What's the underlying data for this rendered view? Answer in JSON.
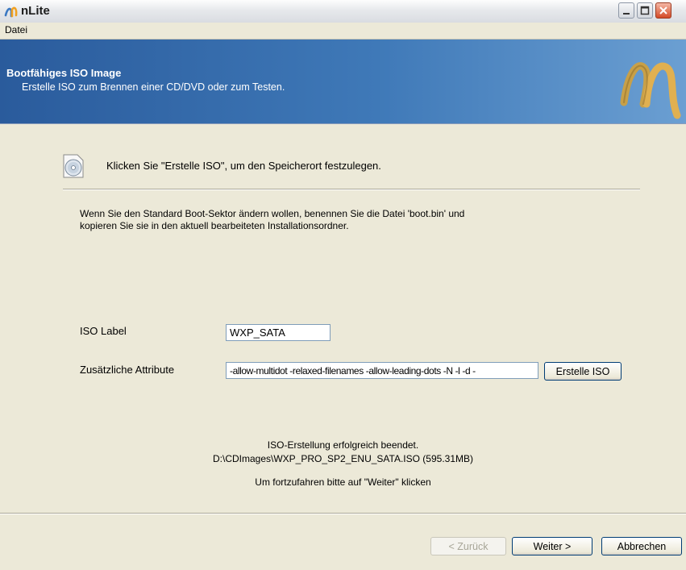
{
  "window": {
    "title": "nLite"
  },
  "menu": {
    "items": [
      "Datei"
    ]
  },
  "header": {
    "title": "Bootfähiges ISO Image",
    "subtitle": "Erstelle ISO zum Brennen einer CD/DVD oder zum Testen."
  },
  "content": {
    "instruction": "Klicken Sie \"Erstelle ISO\", um den Speicherort festzulegen.",
    "info_line1": "Wenn Sie den Standard Boot-Sektor ändern wollen, benennen Sie die Datei 'boot.bin' und",
    "info_line2": "kopieren Sie sie in den aktuell bearbeiteten Installationsordner.",
    "iso_label": {
      "label": "ISO Label",
      "value": "WXP_SATA"
    },
    "attributes": {
      "label": "Zusätzliche Attribute",
      "value": "-allow-multidot -relaxed-filenames -allow-leading-dots -N -l -d -"
    },
    "create_button": "Erstelle ISO",
    "status_line1": "ISO-Erstellung erfolgreich beendet.",
    "status_line2": "D:\\CDImages\\WXP_PRO_SP2_ENU_SATA.ISO (595.31MB)",
    "continue_hint": "Um fortzufahren bitte auf \"Weiter\" klicken"
  },
  "footer": {
    "back": "< Zurück",
    "next": "Weiter >",
    "cancel": "Abbrechen"
  },
  "icons": [
    "nlite-app-icon",
    "minimize-icon",
    "maximize-icon",
    "close-icon",
    "nlite-logo",
    "cd-icon"
  ],
  "colors": {
    "banner": "#3f79b8",
    "dialog": "#ece9d8",
    "close": "#d34a26"
  }
}
